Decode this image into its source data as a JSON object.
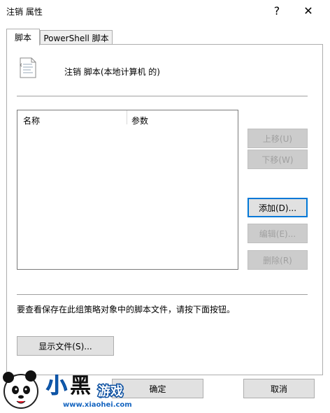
{
  "window": {
    "title": "注销 属性",
    "help_glyph": "?",
    "close_glyph": "✕"
  },
  "tabs": [
    {
      "label": "脚本",
      "active": true
    },
    {
      "label": "PowerShell 脚本",
      "active": false
    }
  ],
  "header": {
    "icon": "script-file-icon",
    "text": "注销 脚本(本地计算机 的)"
  },
  "table": {
    "columns": [
      "名称",
      "参数"
    ],
    "rows": []
  },
  "side_buttons": {
    "up": "上移(U)",
    "down": "下移(W)",
    "add": "添加(D)...",
    "edit": "编辑(E)...",
    "remove": "删除(R)"
  },
  "info_text": "要查看保存在此组策略对象中的脚本文件，请按下面按钮。",
  "show_files_button": "显示文件(S)...",
  "footer": {
    "ok": "确定",
    "cancel": "取消"
  },
  "watermark": {
    "logo_text": "小黑游戏",
    "url": "www.xiaohei.com"
  }
}
